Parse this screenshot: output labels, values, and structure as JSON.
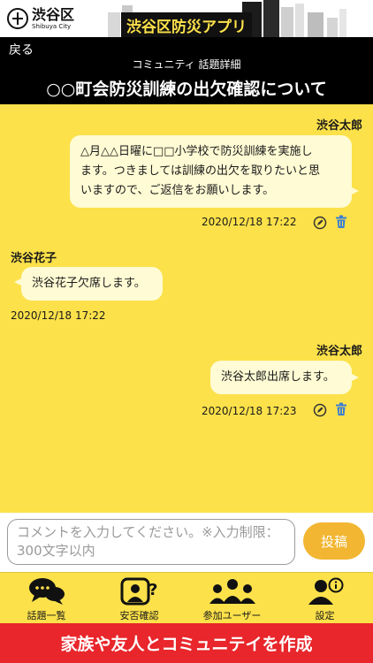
{
  "brand": {
    "name": "渋谷区",
    "sub": "Shibuya City",
    "app_title": "渋谷区防災アプリ"
  },
  "header": {
    "back_label": "戻る",
    "subtitle": "コミュニティ 話題詳細",
    "title": "○○町会防災訓練の出欠確認について"
  },
  "messages": [
    {
      "author": "渋谷太郎",
      "side": "right",
      "lines": [
        "△月△△日曜に□□小学校で防災訓練を実施し",
        "ます。つきましては訓練の出欠を取りたいと思",
        "いますので、ご返信をお願いします。"
      ],
      "time": "2020/12/18 17:22",
      "editable": true
    },
    {
      "author": "渋谷花子",
      "side": "left",
      "lines": [
        "渋谷花子欠席します。"
      ],
      "time": "2020/12/18 17:22",
      "editable": false
    },
    {
      "author": "渋谷太郎",
      "side": "right",
      "lines": [
        "渋谷太郎出席します。"
      ],
      "time": "2020/12/18 17:23",
      "editable": true
    }
  ],
  "composer": {
    "placeholder": "コメントを入力してください。※入力制限：300文字以内",
    "post_label": "投稿"
  },
  "tabs": [
    {
      "label": "話題一覧",
      "icon": "chat-bubbles-icon"
    },
    {
      "label": "安否確認",
      "icon": "person-question-icon"
    },
    {
      "label": "参加ユーザー",
      "icon": "group-users-icon"
    },
    {
      "label": "設定",
      "icon": "person-info-icon"
    }
  ],
  "banner": {
    "label": "家族や友人とコミュニテイを作成"
  },
  "colors": {
    "background": "#fce14a",
    "bubble": "#fffbd4",
    "header": "#000000",
    "post_button": "#f2b632",
    "banner": "#e8262b",
    "trash": "#3d7fd1"
  }
}
